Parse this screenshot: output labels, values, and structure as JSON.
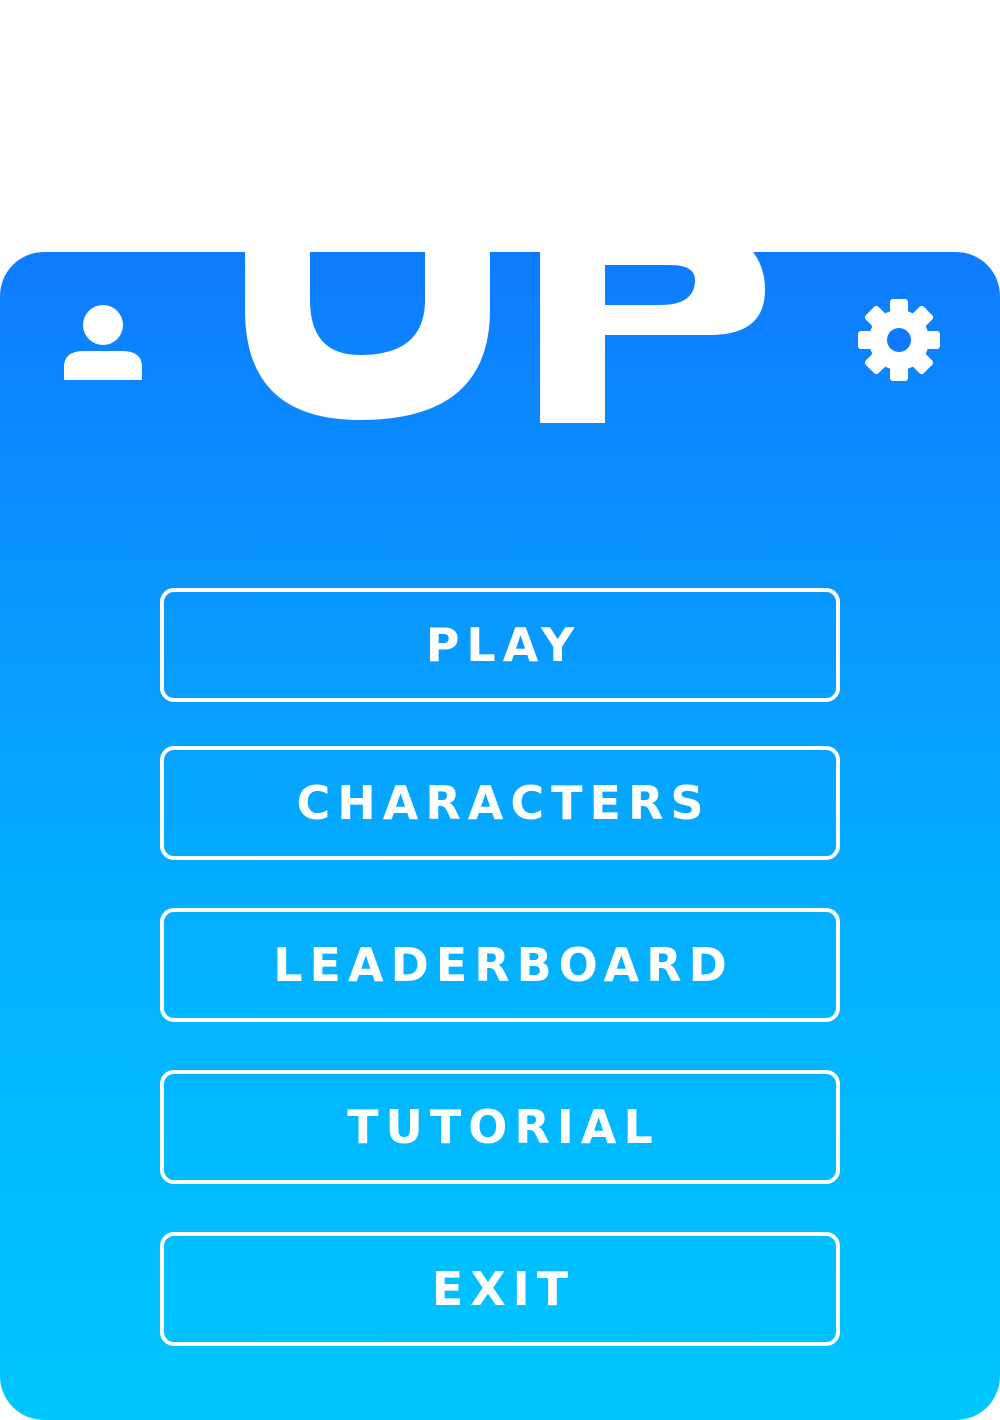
{
  "logo": {
    "text": "UP",
    "icon": "up-arrow-icon",
    "color": "#ffffff"
  },
  "header": {
    "profile_icon": "user-icon",
    "settings_icon": "gear-icon"
  },
  "menu": {
    "items": [
      {
        "id": "play",
        "label": "PLAY"
      },
      {
        "id": "characters",
        "label": "CHARACTERS"
      },
      {
        "id": "leaderboard",
        "label": "LEADERBOARD"
      },
      {
        "id": "tutorial",
        "label": "TUTORIAL"
      },
      {
        "id": "exit",
        "label": "EXIT"
      }
    ]
  },
  "colors": {
    "gradient_top": "#0e7bff",
    "gradient_bottom": "#00c6ff",
    "foreground": "#ffffff"
  }
}
